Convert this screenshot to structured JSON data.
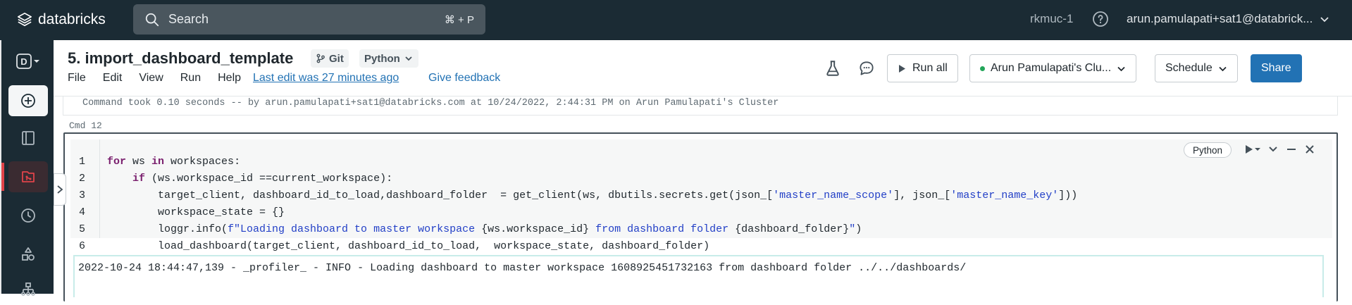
{
  "topbar": {
    "brand": "databricks",
    "search_placeholder": "Search",
    "search_shortcut": "⌘ + P",
    "region": "rkmuc-1",
    "user": "arun.pamulapati+sat1@databrick..."
  },
  "sidebar": {
    "workspace_letter": "D",
    "items": [
      {
        "icon": "plus-circle-icon"
      },
      {
        "icon": "notebook-icon"
      },
      {
        "icon": "repos-icon"
      },
      {
        "icon": "clock-icon"
      },
      {
        "icon": "shapes-icon"
      },
      {
        "icon": "network-icon"
      }
    ]
  },
  "header": {
    "title": "5. import_dashboard_template",
    "git_label": "Git",
    "language_label": "Python",
    "menu": [
      "File",
      "Edit",
      "View",
      "Run",
      "Help"
    ],
    "last_edit": "Last edit was 27 minutes ago",
    "feedback": "Give feedback",
    "run_all": "Run all",
    "cluster": "Arun Pamulapati's Clu...",
    "schedule": "Schedule",
    "share": "Share"
  },
  "notebook": {
    "previous_output": "Command took 0.10 seconds -- by arun.pamulapati+sat1@databricks.com at 10/24/2022, 2:44:31 PM on Arun Pamulapati's Cluster",
    "cmd_label": "Cmd 12",
    "cell_language": "Python",
    "line_numbers": [
      "1",
      "2",
      "3",
      "4",
      "5",
      "6"
    ],
    "code": {
      "l1": {
        "kw1": "for",
        "a": " ws ",
        "kw2": "in",
        "b": " workspaces:"
      },
      "l2": {
        "indent": "    ",
        "kw": "if",
        "rest": " (ws.workspace_id ==current_workspace):"
      },
      "l3": {
        "a": "        target_client, dashboard_id_to_load,dashboard_folder  = get_client(ws, dbutils.secrets.get(json_[",
        "s1": "'master_name_scope'",
        "b": "], json_[",
        "s2": "'master_name_key'",
        "c": "]))"
      },
      "l4": "        workspace_state = {}",
      "l5": {
        "a": "        loggr.info(",
        "s1": "f\"Loading dashboard to master workspace ",
        "b": "{ws.workspace_id}",
        "s2": " from dashboard folder ",
        "c": "{dashboard_folder}",
        "s3": "\"",
        "d": ")"
      },
      "l6": "        load_dashboard(target_client, dashboard_id_to_load,  workspace_state, dashboard_folder)"
    },
    "output": "2022-10-24 18:44:47,139 - _profiler_ - INFO - Loading dashboard to master workspace 1608925451732163 from dashboard folder ../../dashboards/"
  }
}
